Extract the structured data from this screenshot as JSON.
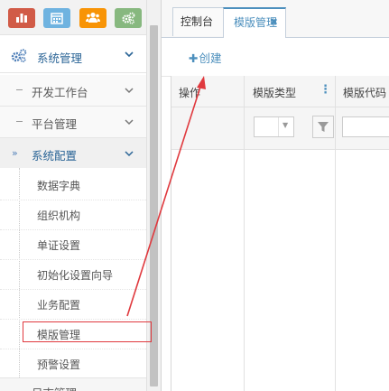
{
  "shortcuts": [
    {
      "name": "chart-icon",
      "color": "#d15b47"
    },
    {
      "name": "calendar-icon",
      "color": "#6fb3e0"
    },
    {
      "name": "users-icon",
      "color": "#f89406"
    },
    {
      "name": "cogs-icon",
      "color": "#87b87f"
    }
  ],
  "sidebar": {
    "top_menu": {
      "label": "系统管理",
      "icon": "cogs-icon"
    },
    "groups": [
      {
        "label": "开发工作台"
      },
      {
        "label": "平台管理"
      },
      {
        "label": "系统配置"
      }
    ],
    "sub_items": [
      {
        "label": "数据字典"
      },
      {
        "label": "组织机构"
      },
      {
        "label": "单证设置"
      },
      {
        "label": "初始化设置向导"
      },
      {
        "label": "业务配置"
      },
      {
        "label": "模版管理"
      },
      {
        "label": "预警设置"
      }
    ],
    "bottom_item": {
      "label": "日志管理"
    }
  },
  "tabs": [
    {
      "label": "控制台"
    },
    {
      "label": "模版管理",
      "close": "✖"
    }
  ],
  "toolbar": {
    "create_plus": "✚",
    "create_label": "创建"
  },
  "grid": {
    "columns": [
      {
        "label": "操作"
      },
      {
        "label": "模版类型"
      },
      {
        "label": "模版代码"
      }
    ],
    "column_menu": "⋮"
  },
  "colors": {
    "accent": "#4c8fbd",
    "annotation": "#e0393e"
  }
}
